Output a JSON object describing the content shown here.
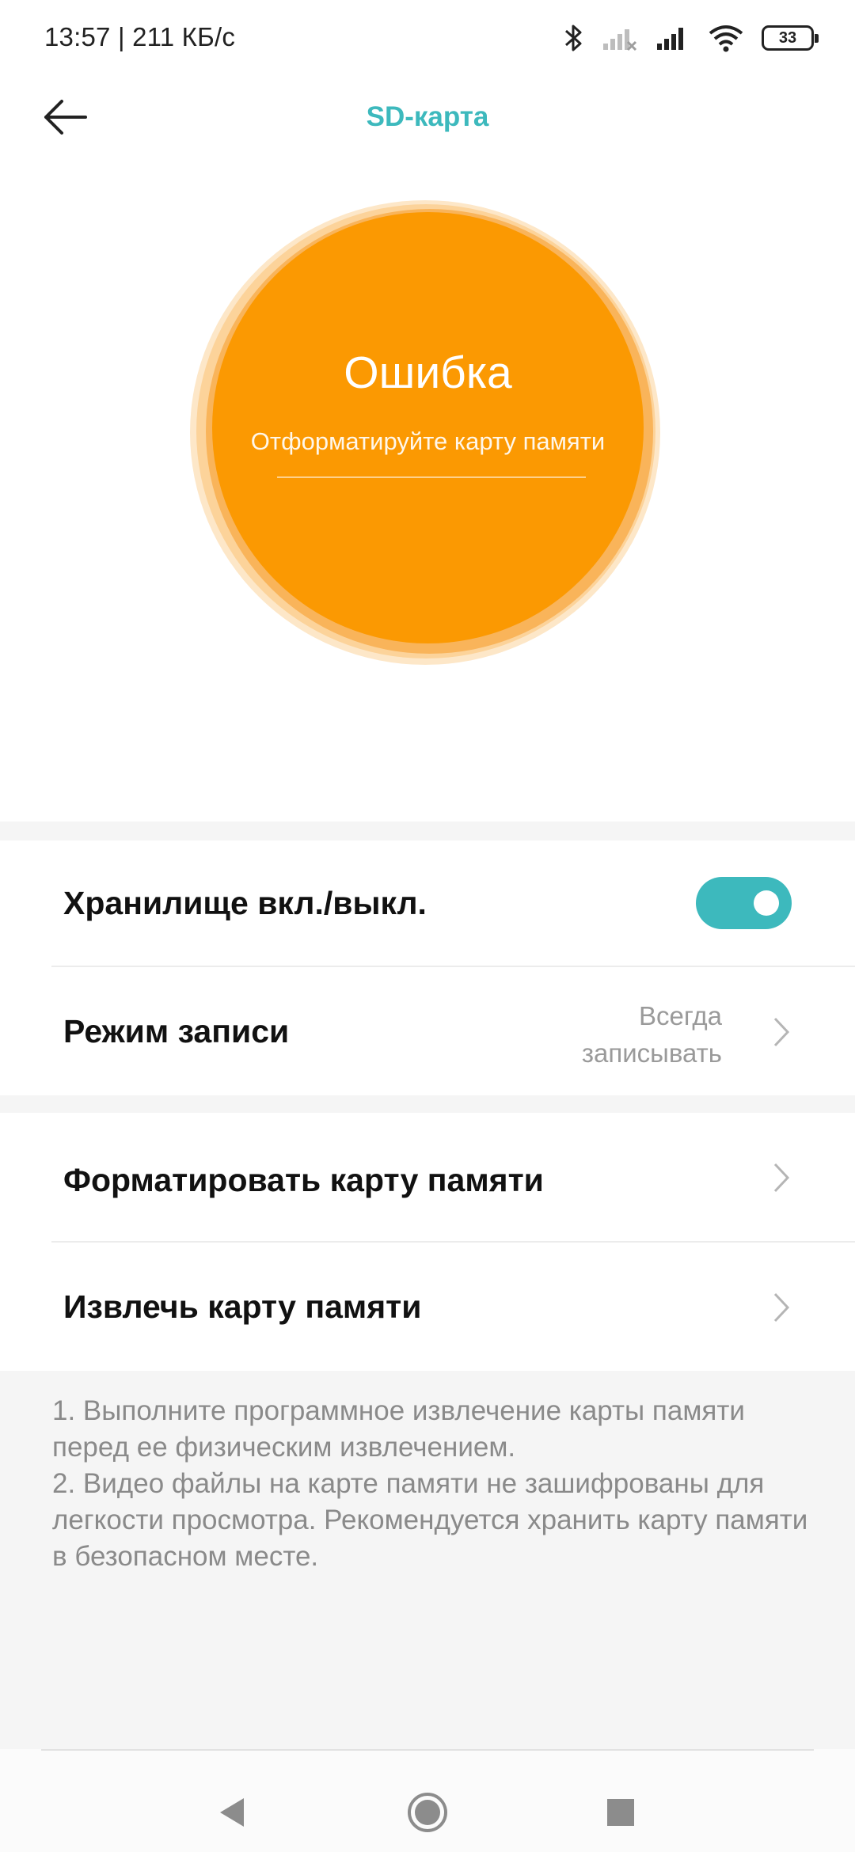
{
  "status_bar": {
    "time_and_speed": "13:57 | 211 КБ/с",
    "battery": "33",
    "icons": [
      "bluetooth-icon",
      "signal-weak-icon",
      "signal-icon",
      "wifi-icon",
      "battery-icon"
    ]
  },
  "header": {
    "title": "SD-карта",
    "back_icon": "arrow-left-icon"
  },
  "status_card": {
    "title": "Ошибка",
    "subtitle": "Отформатируйте карту памяти",
    "color": "#fb9902"
  },
  "settings": {
    "storage_toggle": {
      "label": "Хранилище вкл./выкл.",
      "enabled": true
    },
    "record_mode": {
      "label": "Режим записи",
      "value_line1": "Всегда",
      "value_line2": "записывать"
    },
    "format_card": {
      "label": "Форматировать карту памяти"
    },
    "eject_card": {
      "label": "Извлечь карту памяти"
    }
  },
  "notes": {
    "note1": "1. Выполните программное извлечение карты памяти перед ее физическим извлечением.",
    "note2": "2. Видео файлы на карте памяти не зашифрованы для легкости просмотра. Рекомендуется хранить карту памяти в безопасном месте."
  },
  "nav_bar": {
    "icons": [
      "back-triangle-icon",
      "home-circle-icon",
      "recents-square-icon"
    ]
  },
  "colors": {
    "accent": "#3db9bd",
    "error_orange": "#fb9902",
    "secondary_text": "#8a8a8a"
  }
}
